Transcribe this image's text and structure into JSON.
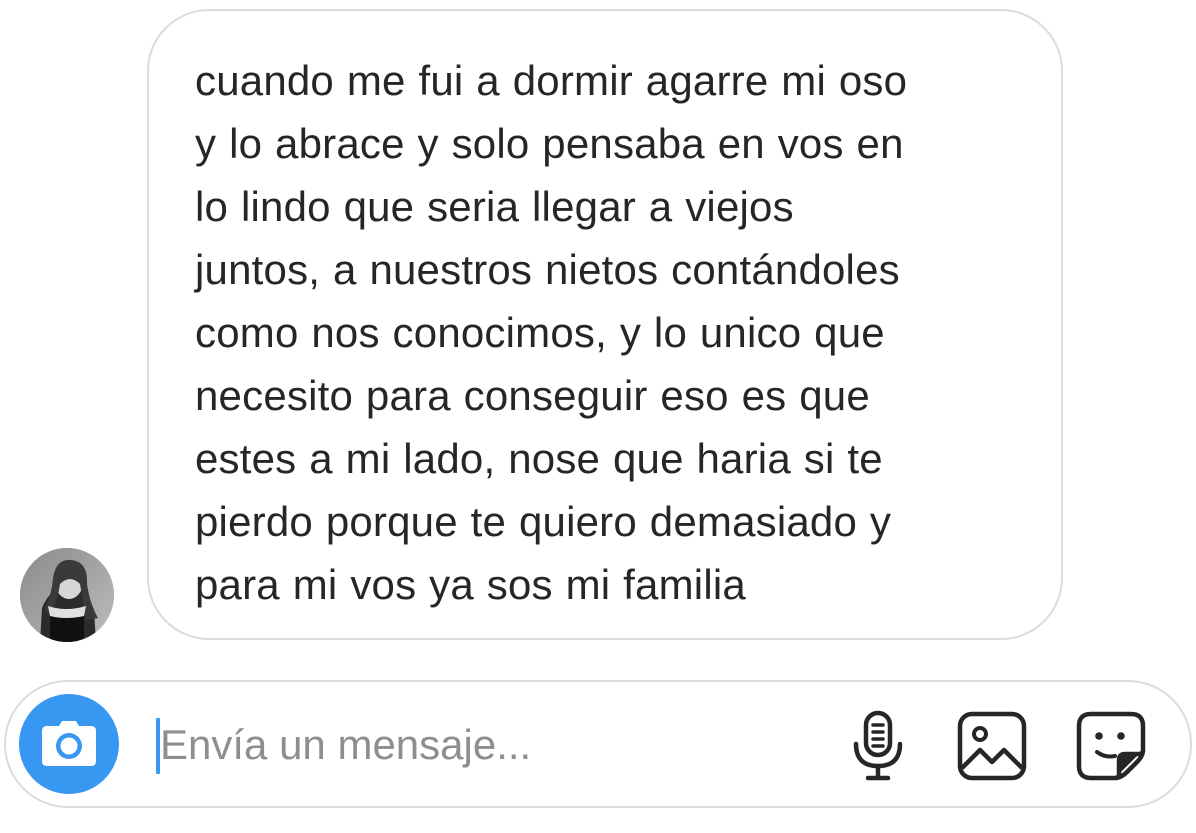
{
  "conversation": {
    "message": {
      "text": "cuando me fui a dormir agarre mi oso y lo abrace y solo pensaba en vos en lo lindo que seria llegar a viejos juntos, a nuestros nietos contándoles como nos conocimos, y lo unico que necesito para conseguir eso es que estes a mi lado, nose que haria si te pierdo porque te quiero demasiado y para mi vos ya sos mi familia",
      "lines": [
        "cuando me fui a dormir agarre mi oso",
        "y lo abrace y solo pensaba en vos en",
        "lo lindo que seria llegar a viejos",
        "juntos, a nuestros nietos contándoles",
        "como nos conocimos, y lo unico que",
        "necesito para conseguir eso es que",
        "estes a mi lado, nose que haria si te",
        "pierdo porque te quiero demasiado y",
        "para mi vos ya sos mi familia"
      ]
    },
    "sender_avatar": "avatar-photo"
  },
  "composer": {
    "placeholder": "Envía un mensaje...",
    "value": "",
    "icons": {
      "camera": "camera-icon",
      "microphone": "microphone-icon",
      "gallery": "gallery-icon",
      "sticker": "sticker-icon"
    }
  },
  "colors": {
    "accent": "#3897f0",
    "border": "#dbdbdb",
    "text": "#262626",
    "placeholder": "#8e8e8e"
  }
}
